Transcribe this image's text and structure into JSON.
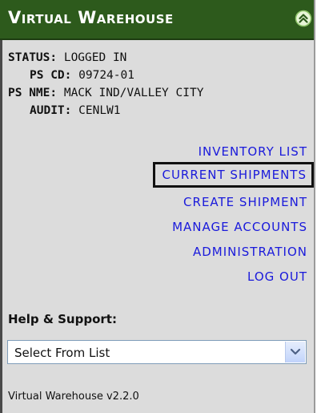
{
  "header": {
    "title": "Virtual Warehouse",
    "collapse_icon": "double-chevron-up-icon"
  },
  "status": [
    {
      "label": "STATUS:",
      "value": "LOGGED IN"
    },
    {
      "label": "PS CD:",
      "value": "09724-01"
    },
    {
      "label": "PS NME:",
      "value": "MACK IND/VALLEY CITY"
    },
    {
      "label": "AUDIT:",
      "value": "CENLW1"
    }
  ],
  "nav": [
    {
      "label": "INVENTORY LIST"
    },
    {
      "label": "CURRENT SHIPMENTS",
      "active": true
    },
    {
      "label": "CREATE SHIPMENT"
    },
    {
      "label": "MANAGE ACCOUNTS"
    },
    {
      "label": "ADMINISTRATION"
    },
    {
      "label": "LOG OUT"
    }
  ],
  "help": {
    "label": "Help & Support:",
    "selected": "Select From List",
    "arrow_icon": "chevron-down-icon"
  },
  "footer": {
    "version": "Virtual Warehouse v2.2.0"
  },
  "colors": {
    "header_bg": "#2d5a1c",
    "link": "#1a1adb",
    "panel_bg": "#dcdcdc"
  }
}
